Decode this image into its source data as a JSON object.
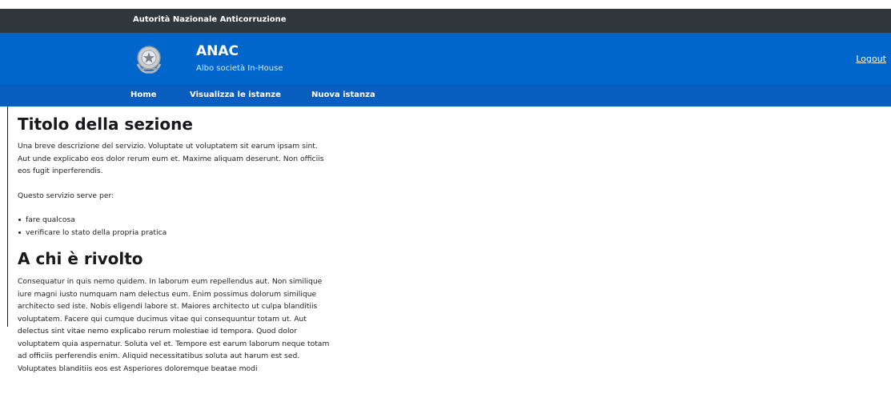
{
  "colors": {
    "slim_header_bg": "#30373d",
    "header_bg": "#0066cc",
    "navbar_bg": "#0a5ebf",
    "text": "#222222"
  },
  "slim_header": {
    "owner": "Autorità Nazionale Anticorruzione"
  },
  "header": {
    "emblem_icon": "italian-republic-emblem-icon",
    "title": "ANAC",
    "subtitle": "Albo società In-House",
    "logout_label": "Logout"
  },
  "nav": {
    "items": [
      {
        "label": "Home"
      },
      {
        "label": "Visualizza le istanze"
      },
      {
        "label": "Nuova istanza"
      }
    ]
  },
  "content": {
    "section1_title": "Titolo della sezione",
    "section1_description": "Una breve descrizione del servizio. Voluptate ut voluptatem sit earum ipsam sint. Aut unde explicabo eos dolor rerum eum et. Maxime aliquam deserunt. Non officiis eos fugit inperferendis.",
    "service_intro": "Questo servizio serve per:",
    "bullets": [
      "fare qualcosa",
      "verificare lo stato della propria pratica"
    ],
    "section2_title": "A chi è rivolto",
    "section2_body": "Consequatur in quis nemo quidem. In laborum eum repellendus aut. Non similique iure magni iusto numquam nam delectus eum. Enim possimus dolorum similique architecto sed iste. Nobis eligendi labore st. Maiores architecto ut culpa blanditiis voluptatem. Facere qui cumque ducimus vitae qui consequuntur totam ut. Aut delectus sint vitae nemo explicabo rerum molestiae id tempora. Quod dolor voluptatem quia aspernatur. Soluta vel et. Tempore est earum laborum neque totam ad officiis perferendis enim. Aliquid necessitatibus soluta aut harum est sed. Voluptates blanditiis eos est Asperiores doloremque beatae modi"
  }
}
